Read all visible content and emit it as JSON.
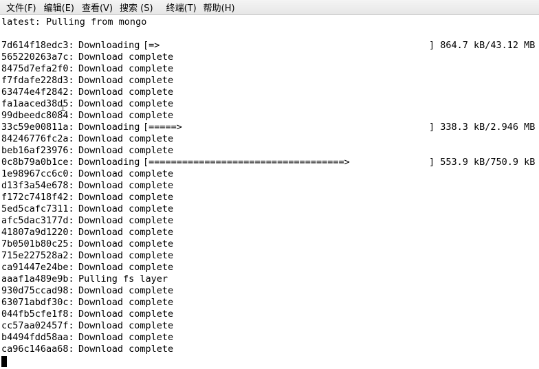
{
  "menu": {
    "items": [
      "文件(F)",
      "编辑(E)",
      "查看(V)",
      "搜索 (S)",
      "终端(T)",
      "帮助(H)"
    ]
  },
  "terminal": {
    "header": "latest: Pulling from mongo",
    "layers": [
      {
        "id": "7d614f18edc3:",
        "status": "Downloading",
        "bar": "[=>",
        "progress": "] 864.7 kB/43.12 MB"
      },
      {
        "id": "565220263a7c:",
        "status": "Download complete"
      },
      {
        "id": "8475d7efa2f0:",
        "status": "Download complete"
      },
      {
        "id": "f7fdafe228d3:",
        "status": "Download complete"
      },
      {
        "id": "63474e4f2842:",
        "status": "Download complete"
      },
      {
        "id": "fa1aaced38d5:",
        "status": "Download complete"
      },
      {
        "id": "99dbeedc8084:",
        "status": "Download complete"
      },
      {
        "id": "33c59e00811a:",
        "status": "Downloading",
        "bar": "[=====>",
        "progress": "] 338.3 kB/2.946 MB"
      },
      {
        "id": "84246776fc2a:",
        "status": "Download complete"
      },
      {
        "id": "beb16af23976:",
        "status": "Download complete"
      },
      {
        "id": "0c8b79a0b1ce:",
        "status": "Downloading",
        "bar": "[===================================>",
        "progress": "] 553.9 kB/750.9 kB"
      },
      {
        "id": "1e98967cc6c0:",
        "status": "Download complete"
      },
      {
        "id": "d13f3a54e678:",
        "status": "Download complete"
      },
      {
        "id": "f172c7418f42:",
        "status": "Download complete"
      },
      {
        "id": "5ed5cafc7311:",
        "status": "Download complete"
      },
      {
        "id": "afc5dac3177d:",
        "status": "Download complete"
      },
      {
        "id": "41807a9d1220:",
        "status": "Download complete"
      },
      {
        "id": "7b0501b80c25:",
        "status": "Download complete"
      },
      {
        "id": "715e227528a2:",
        "status": "Download complete"
      },
      {
        "id": "ca91447e24be:",
        "status": "Download complete"
      },
      {
        "id": "aaaf1a489e9b:",
        "status": "Pulling fs layer"
      },
      {
        "id": "930d75ccad98:",
        "status": "Download complete"
      },
      {
        "id": "63071abdf30c:",
        "status": "Download complete"
      },
      {
        "id": "044fb5cfe1f8:",
        "status": "Download complete"
      },
      {
        "id": "cc57aa02457f:",
        "status": "Download complete"
      },
      {
        "id": "b4494fdd58aa:",
        "status": "Download complete"
      },
      {
        "id": "ca96c146aa68:",
        "status": "Download complete"
      }
    ]
  }
}
